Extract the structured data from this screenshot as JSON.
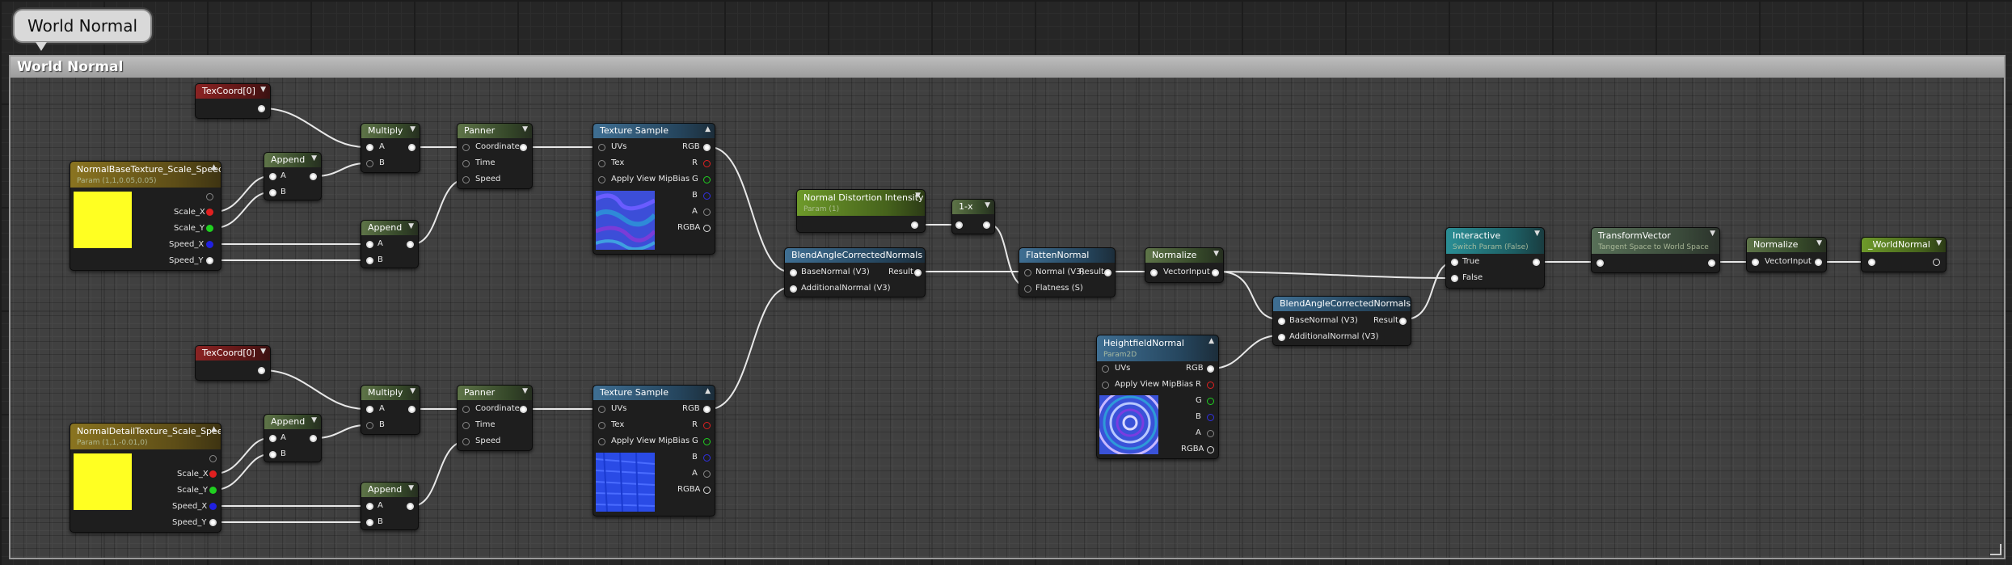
{
  "bubble": {
    "label": "World Normal"
  },
  "comment": {
    "title": "World Normal"
  },
  "nodes": {
    "texcoord_top": {
      "title": "TexCoord[0]"
    },
    "texcoord_bottom": {
      "title": "TexCoord[0]"
    },
    "param_base": {
      "title": "NormalBaseTexture_Scale_Speed",
      "subtitle": "Param (1,1,0.05,0.05)",
      "pins": [
        "Scale_X",
        "Scale_Y",
        "Speed_X",
        "Speed_Y"
      ]
    },
    "param_detail": {
      "title": "NormalDetailTexture_Scale_Speed",
      "subtitle": "Param (1,1,-0.01,0)",
      "pins": [
        "Scale_X",
        "Scale_Y",
        "Speed_X",
        "Speed_Y"
      ]
    },
    "append_top_a": {
      "title": "Append",
      "pins": [
        "A",
        "B"
      ]
    },
    "append_top_b": {
      "title": "Append",
      "pins": [
        "A",
        "B"
      ]
    },
    "append_bot_a": {
      "title": "Append",
      "pins": [
        "A",
        "B"
      ]
    },
    "append_bot_b": {
      "title": "Append",
      "pins": [
        "A",
        "B"
      ]
    },
    "multiply_top": {
      "title": "Multiply",
      "pins": [
        "A",
        "B"
      ]
    },
    "multiply_bot": {
      "title": "Multiply",
      "pins": [
        "A",
        "B"
      ]
    },
    "panner_top": {
      "title": "Panner",
      "pins": [
        "Coordinate",
        "Time",
        "Speed"
      ]
    },
    "panner_bot": {
      "title": "Panner",
      "pins": [
        "Coordinate",
        "Time",
        "Speed"
      ]
    },
    "texsample_top": {
      "title": "Texture Sample",
      "inputs": [
        "UVs",
        "Tex",
        "Apply View MipBias"
      ],
      "outputs": [
        "RGB",
        "R",
        "G",
        "B",
        "A",
        "RGBA"
      ]
    },
    "texsample_bot": {
      "title": "Texture Sample",
      "inputs": [
        "UVs",
        "Tex",
        "Apply View MipBias"
      ],
      "outputs": [
        "RGB",
        "R",
        "G",
        "B",
        "A",
        "RGBA"
      ]
    },
    "distortion": {
      "title": "Normal Distortion Intensity",
      "subtitle": "Param (1)"
    },
    "one_minus": {
      "title": "1-x"
    },
    "blend_1": {
      "title": "BlendAngleCorrectedNormals",
      "inputs": [
        "BaseNormal (V3)",
        "AdditionalNormal (V3)"
      ],
      "output": "Result"
    },
    "flatten": {
      "title": "FlattenNormal",
      "inputs": [
        "Normal (V3)",
        "Flatness (S)"
      ],
      "output": "Result"
    },
    "normalize_1": {
      "title": "Normalize",
      "input": "VectorInput"
    },
    "heightfield": {
      "title": "HeightfieldNormal",
      "subtitle": "Param2D",
      "inputs": [
        "UVs",
        "Apply View MipBias"
      ],
      "outputs": [
        "RGB",
        "R",
        "G",
        "B",
        "A",
        "RGBA"
      ]
    },
    "blend_2": {
      "title": "BlendAngleCorrectedNormals",
      "inputs": [
        "BaseNormal (V3)",
        "AdditionalNormal (V3)"
      ],
      "output": "Result"
    },
    "interactive": {
      "title": "Interactive",
      "subtitle": "Switch Param (False)",
      "inputs": [
        "True",
        "False"
      ]
    },
    "transform": {
      "title": "TransformVector",
      "subtitle": "Tangent Space to World Space"
    },
    "normalize_2": {
      "title": "Normalize",
      "input": "VectorInput"
    },
    "world_normal": {
      "title": "_WorldNormal"
    }
  },
  "colors": {
    "param_swatch": "#ffff22",
    "pin_red": "#e02020",
    "pin_green": "#20d020",
    "pin_blue": "#2020e0",
    "wire": "#e8e8e8"
  },
  "icons": [
    "collapse-chevron-icon",
    "output-pin-icon",
    "input-pin-icon",
    "exec-arrow-icon"
  ]
}
